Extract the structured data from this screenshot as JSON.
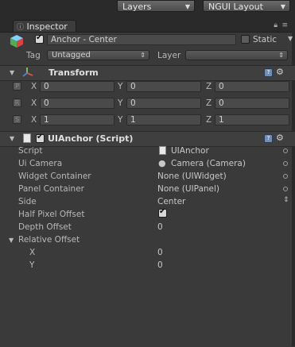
{
  "topbar": {
    "layers_dropdown": "Layers",
    "layout_dropdown": "NGUI Layout"
  },
  "window": {
    "tab_title": "Inspector"
  },
  "gameobject": {
    "name": "Anchor - Center",
    "active": true,
    "static_label": "Static",
    "static_checked": false,
    "tag_label": "Tag",
    "tag_value": "Untagged",
    "layer_label": "Layer",
    "layer_value": ""
  },
  "transform": {
    "title": "Transform",
    "rows": [
      {
        "button": "P",
        "x_label": "X",
        "x": "0",
        "y_label": "Y",
        "y": "0",
        "z_label": "Z",
        "z": "0"
      },
      {
        "button": "R",
        "x_label": "X",
        "x": "0",
        "y_label": "Y",
        "y": "0",
        "z_label": "Z",
        "z": "0"
      },
      {
        "button": "S",
        "x_label": "X",
        "x": "1",
        "y_label": "Y",
        "y": "1",
        "z_label": "Z",
        "z": "1"
      }
    ]
  },
  "uianchor": {
    "title": "UIAnchor (Script)",
    "enabled": true,
    "props": [
      {
        "label": "Script",
        "value": "UIAnchor",
        "icon": "script-file-icon"
      },
      {
        "label": "Ui Camera",
        "value": "Camera (Camera)",
        "icon": "camera-icon"
      },
      {
        "label": "Widget Container",
        "value": "None (UIWidget)"
      },
      {
        "label": "Panel Container",
        "value": "None (UIPanel)"
      },
      {
        "label": "Side",
        "value": "Center"
      },
      {
        "label": "Half Pixel Offset",
        "value_checked": true
      },
      {
        "label": "Depth Offset",
        "value": "0"
      },
      {
        "label": "Relative Offset",
        "value": ""
      },
      {
        "label": "X",
        "value": "0"
      },
      {
        "label": "Y",
        "value": "0"
      }
    ]
  },
  "colors": {
    "panel_bg": "#3a3a3a",
    "header_bg": "#3f3f3f",
    "field_bg": "#4a4a4a",
    "text": "#bdbdbd"
  }
}
